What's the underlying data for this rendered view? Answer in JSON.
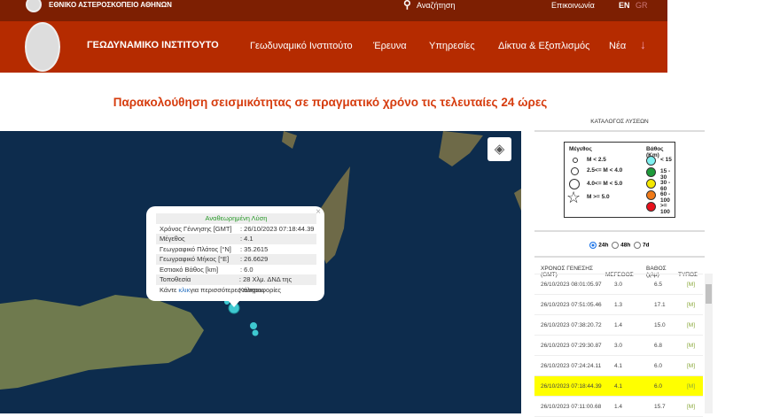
{
  "topbar": {
    "org": "ΕΘΝΙΚΟ ΑΣΤΕΡΟΣΚΟΠΕΙΟ ΑΘΗΝΩΝ",
    "search": "Αναζήτηση",
    "contact": "Επικοινωνία",
    "lang_en": "EN",
    "lang_gr": "GR"
  },
  "navbar": {
    "brand": "ΓΕΩΔΥΝΑΜΙΚΟ ΙΝΣΤΙΤΟΥΤΟ",
    "items": [
      "Γεωδυναμικό Ινστιτούτο",
      "Έρευνα",
      "Υπηρεσίες",
      "Δίκτυα & Εξοπλισμός",
      "Νέα"
    ],
    "more": "↓"
  },
  "page_title": "Παρακολούθηση σεισμικότητας σε πραγματικό χρόνο τις τελευταίες 24 ώρες",
  "popup": {
    "header": "Αναθεωρημένη Λύση",
    "rows": [
      {
        "k": "Χρόνος Γέννησης [GMT]",
        "v": ": 26/10/2023 07:18:44.39"
      },
      {
        "k": "Μέγεθος",
        "v": ": 4.1"
      },
      {
        "k": "Γεωγραφικό Πλάτος [°N]",
        "v": ": 35.2615"
      },
      {
        "k": "Γεωγραφικό Μήκος [°E]",
        "v": ": 26.6629"
      },
      {
        "k": "Εστιακό Βάθος [km]",
        "v": ": 6.0"
      },
      {
        "k": "Τοποθεσία",
        "v": ": 28 Χλμ. ΔΝΔ της Κάσσου"
      }
    ],
    "more_pre": "Κάντε ",
    "more_link": "κλικ",
    "more_post": " για περισσότερες πληροφορίες",
    "close": "×"
  },
  "panel": {
    "catalog": "ΚΑΤΑΛΟΓΟΣ ΛΥΣΕΩΝ",
    "legend": {
      "mag_title": "Μέγεθος",
      "mag": [
        "M < 2.5",
        "2.5<= M < 4.0",
        "4.0<= M < 5.0",
        "M >= 5.0"
      ],
      "depth_title": "Βάθος (Km)",
      "depth": [
        {
          "label": "< 15",
          "color": "#7ff0f0"
        },
        {
          "label": "15 - 30",
          "color": "#1e9a3a"
        },
        {
          "label": "30 - 60",
          "color": "#f5e800"
        },
        {
          "label": "60 - 100",
          "color": "#f07a18"
        },
        {
          "label": ">= 100",
          "color": "#e8101c"
        }
      ]
    },
    "periods": [
      "24h",
      "48h",
      "7d"
    ],
    "selected_period": "24h",
    "columns": [
      "ΧΡΟΝΟΣ ΓΕΝΕΣΗΣ (GMT)",
      "ΜΕΓΕΘΟΣ",
      "ΒΑΘΟΣ (χλμ)",
      "ΤΥΠΟΣ"
    ],
    "rows": [
      [
        "26/10/2023 08:01:05.97",
        "3.0",
        "6.5",
        "[M]"
      ],
      [
        "26/10/2023 07:51:05.46",
        "1.3",
        "17.1",
        "[M]"
      ],
      [
        "26/10/2023 07:38:20.72",
        "1.4",
        "15.0",
        "[M]"
      ],
      [
        "26/10/2023 07:29:30.87",
        "3.0",
        "6.8",
        "[M]"
      ],
      [
        "26/10/2023 07:24:24.11",
        "4.1",
        "6.0",
        "[M]"
      ],
      [
        "26/10/2023 07:18:44.39",
        "4.1",
        "6.0",
        "[M]"
      ],
      [
        "26/10/2023 07:11:00.68",
        "1.4",
        "15.7",
        "[M]"
      ]
    ],
    "highlighted_row": 5,
    "highlight_color": "#ffff00"
  }
}
